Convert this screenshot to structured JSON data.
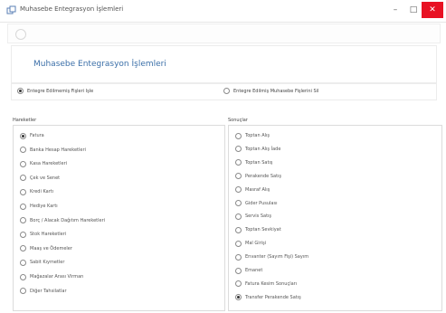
{
  "window": {
    "title": "Muhasebe Entegrasyon İşlemleri",
    "min_glyph": "–",
    "max_glyph": "□",
    "close_glyph": "✕"
  },
  "header": {
    "title": "Muhasebe Entegrasyon İşlemleri"
  },
  "options": {
    "left_label": "Entegre Edilmemiş Fişleri Işle",
    "right_label": "Entegre Edilmiş Muhasebe Fişlerini Sil",
    "selected": "left"
  },
  "sections": {
    "left_label": "Hareketler",
    "right_label": "Sonuçlar"
  },
  "hareketler": [
    {
      "label": "Fatura",
      "selected": true
    },
    {
      "label": "Banka Hesap Hareketleri",
      "selected": false
    },
    {
      "label": "Kasa Hareketleri",
      "selected": false
    },
    {
      "label": "Çek ve Senet",
      "selected": false
    },
    {
      "label": "Kredi Kartı",
      "selected": false
    },
    {
      "label": "Hediye Kartı",
      "selected": false
    },
    {
      "label": "Borç / Alacak Dağıtım Hareketleri",
      "selected": false
    },
    {
      "label": "Stok Hareketleri",
      "selected": false
    },
    {
      "label": "Maaş ve Ödemeler",
      "selected": false
    },
    {
      "label": "Sabit Kıymetler",
      "selected": false
    },
    {
      "label": "Mağazalar Arası Virman",
      "selected": false
    },
    {
      "label": "Diğer Tahsilatlar",
      "selected": false
    }
  ],
  "sonuclar": [
    {
      "label": "Toptan Alış",
      "selected": false
    },
    {
      "label": "Toptan Alış İade",
      "selected": false
    },
    {
      "label": "Toptan Satış",
      "selected": false
    },
    {
      "label": "Perakende Satış",
      "selected": false
    },
    {
      "label": "Masraf Alış",
      "selected": false
    },
    {
      "label": "Gider Pusulası",
      "selected": false
    },
    {
      "label": "Servis Satış",
      "selected": false
    },
    {
      "label": "Toptan Sevkiyat",
      "selected": false
    },
    {
      "label": "Mal Girişi",
      "selected": false
    },
    {
      "label": "Envanter (Sayım Fişi) Sayım",
      "selected": false
    },
    {
      "label": "Emanet",
      "selected": false
    },
    {
      "label": "Fatura Kesim Sonuçları",
      "selected": false
    },
    {
      "label": "Transfer Perakende Satış",
      "selected": true
    }
  ]
}
